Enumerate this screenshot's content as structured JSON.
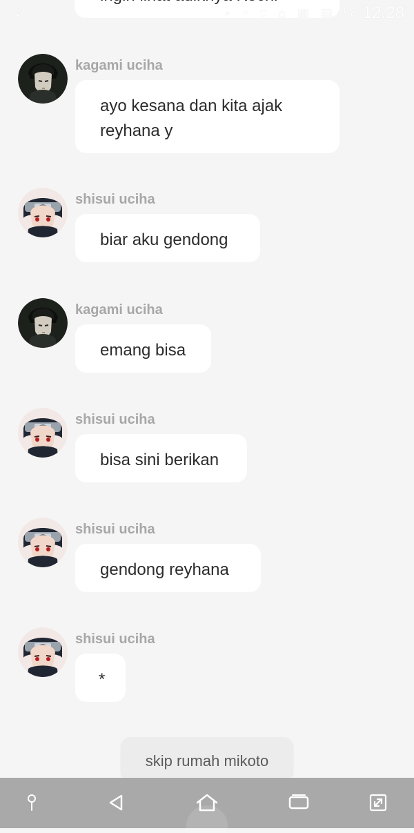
{
  "status_bar": {
    "time": "12.28",
    "glyphs": "◦ ◔ ▾ ⌂ ▥ ▤",
    "battery": "%",
    "left_icon": "music-note-icon"
  },
  "top_partial_message": "ingin lihat adiknya Kechi",
  "messages": [
    {
      "sender": "kagami uciha",
      "text": "ayo kesana dan kita ajak\nreyhana y",
      "avatar": "kagami-avatar"
    },
    {
      "sender": "shisui uciha",
      "text": "biar aku gendong",
      "avatar": "shisui-avatar"
    },
    {
      "sender": "kagami uciha",
      "text": "emang bisa",
      "avatar": "kagami-avatar"
    },
    {
      "sender": "shisui uciha",
      "text": "bisa sini berikan",
      "avatar": "shisui-avatar"
    },
    {
      "sender": "shisui uciha",
      "text": "gendong reyhana",
      "avatar": "shisui-avatar"
    },
    {
      "sender": "shisui uciha",
      "text": "*",
      "avatar": "shisui-avatar"
    }
  ],
  "choice": {
    "label": "skip rumah mikoto"
  },
  "nav": {
    "items": [
      "pin-icon",
      "back-icon",
      "home-icon",
      "recents-icon",
      "screen-expand-icon"
    ]
  },
  "colors": {
    "background": "#f5f5f5",
    "bubble": "#ffffff",
    "sender_text": "#a7a7a7",
    "message_text": "#2c2c2c",
    "nav_bar": "#a9a9a9"
  }
}
